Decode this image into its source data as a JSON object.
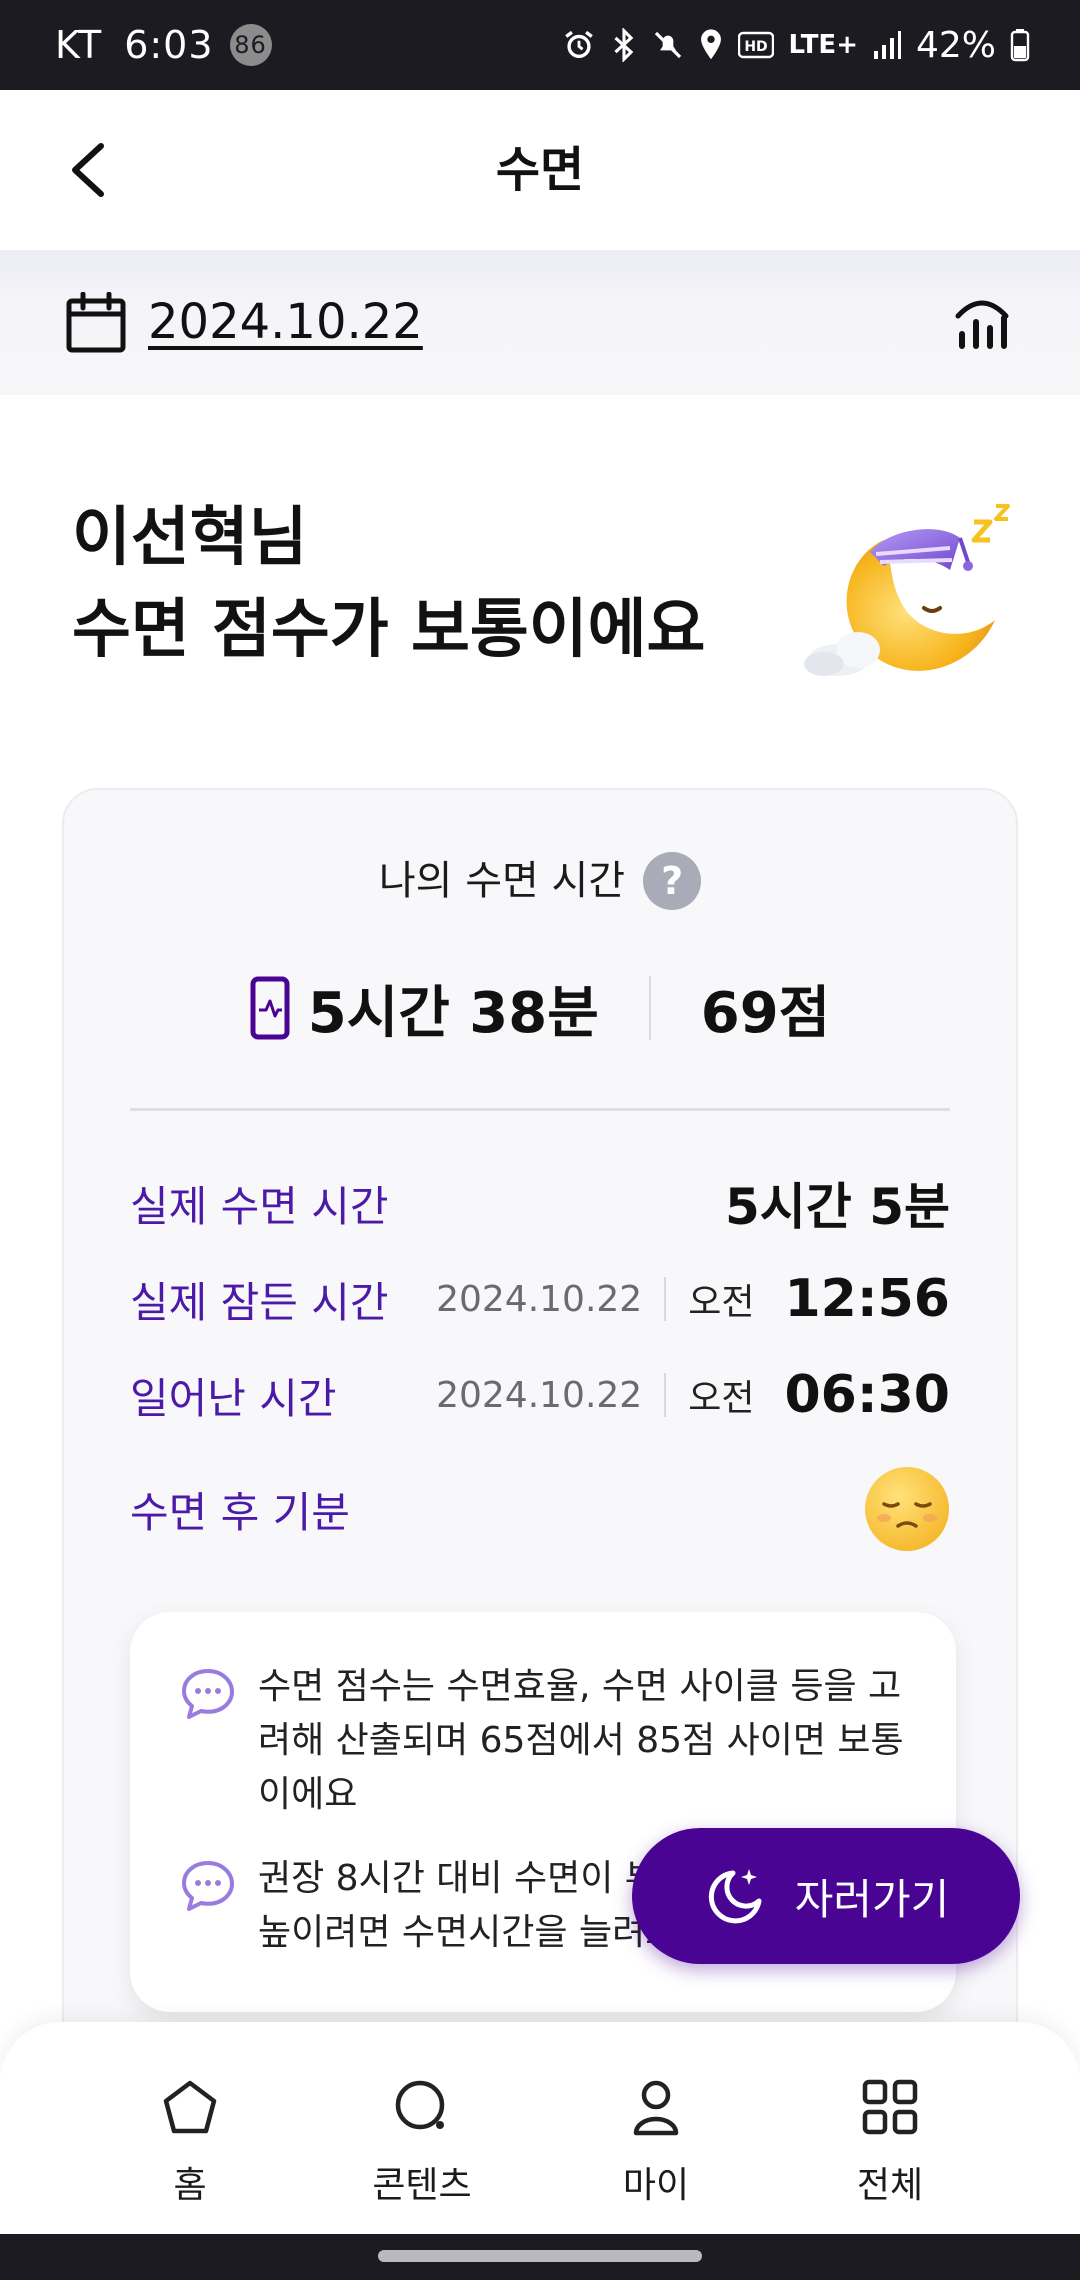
{
  "status_bar": {
    "carrier": "KT",
    "time": "6:03",
    "notification_count": "86",
    "network": "LTE+",
    "battery": "42%"
  },
  "app_bar": {
    "title": "수면"
  },
  "date_bar": {
    "date": "2024.10.22"
  },
  "greeting": {
    "line1": "이선혁님",
    "line2": "수면 점수가 보통이에요"
  },
  "card": {
    "title": "나의 수면 시간",
    "duration": "5시간 38분",
    "score": "69점",
    "rows": {
      "actual_sleep": {
        "label": "실제 수면 시간",
        "value": "5시간 5분"
      },
      "fell_asleep": {
        "label": "실제 잠든 시간",
        "date": "2024.10.22",
        "ampm": "오전",
        "time": "12:56"
      },
      "woke_up": {
        "label": "일어난 시간",
        "date": "2024.10.22",
        "ampm": "오전",
        "time": "06:30"
      },
      "mood": {
        "label": "수면 후 기분"
      }
    },
    "tips": [
      {
        "text": "수면 점수는 수면효율, 수면 사이클 등을 고려해 산출되며 65점에서 85점 사이면 보통이에요"
      },
      {
        "text": "권장 8시간 대비 수면이 부족해요. 점수를 높이려면 수면시간을 늘려보세요"
      }
    ]
  },
  "fab": {
    "label": "자러가기"
  },
  "bottom_nav": {
    "items": [
      {
        "label": "홈"
      },
      {
        "label": "콘텐츠"
      },
      {
        "label": "마이"
      },
      {
        "label": "전체"
      }
    ]
  },
  "colors": {
    "accent": "#4a0494",
    "label_purple": "#4b1aa8",
    "status_bar": "#1c1b22"
  }
}
